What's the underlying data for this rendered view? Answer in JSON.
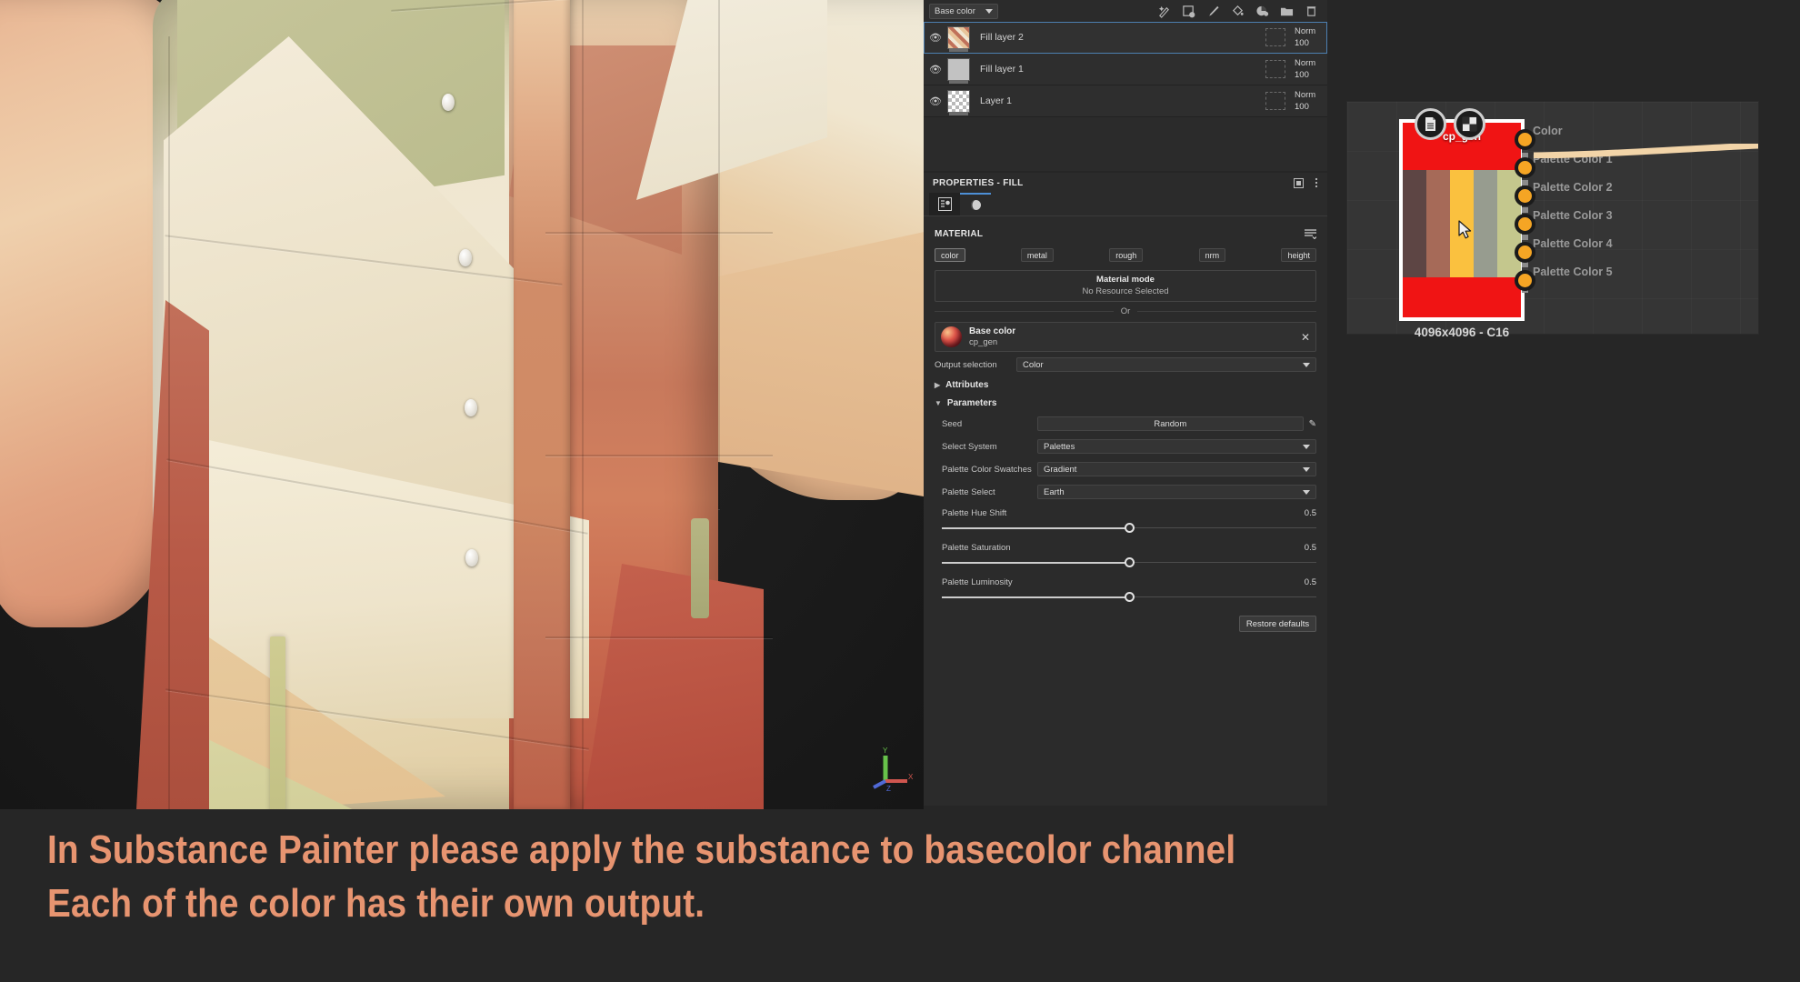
{
  "app": {
    "name": "Substance Painter"
  },
  "layers_panel": {
    "channel_selector": {
      "value": "Base color",
      "icon": "chevron-down-icon"
    },
    "tools": [
      {
        "name": "smart-mask-icon",
        "label": "Smart mask"
      },
      {
        "name": "smart-material-icon",
        "label": "Smart material"
      },
      {
        "name": "paint-layer-icon",
        "label": "Paint layer"
      },
      {
        "name": "fill-layer-icon",
        "label": "Fill layer"
      },
      {
        "name": "generator-icon",
        "label": "Generator"
      },
      {
        "name": "folder-icon",
        "label": "Folder"
      },
      {
        "name": "delete-icon",
        "label": "Delete"
      }
    ],
    "rows": [
      {
        "name": "Fill layer 2",
        "blend": "Norm",
        "opacity": "100",
        "selected": true,
        "thumb": "stripes"
      },
      {
        "name": "Fill layer 1",
        "blend": "Norm",
        "opacity": "100",
        "selected": false,
        "thumb": "grey"
      },
      {
        "name": "Layer 1",
        "blend": "Norm",
        "opacity": "100",
        "selected": false,
        "thumb": "checker"
      }
    ]
  },
  "properties": {
    "title": "PROPERTIES - FILL",
    "header_icons": [
      "dock-icon",
      "menu-icon"
    ],
    "tabs": [
      {
        "name": "properties-tab",
        "icon": "sliders-icon",
        "active": true
      },
      {
        "name": "material-tab",
        "icon": "sphere-icon",
        "active": false
      }
    ],
    "material": {
      "section_label": "MATERIAL",
      "menu_icon": "list-options-icon",
      "channels": [
        {
          "label": "color",
          "active": true
        },
        {
          "label": "metal",
          "active": false
        },
        {
          "label": "rough",
          "active": false
        },
        {
          "label": "nrm",
          "active": false
        },
        {
          "label": "height",
          "active": false
        }
      ],
      "mode_title": "Material mode",
      "mode_value": "No Resource Selected",
      "or_label": "Or",
      "resource": {
        "title": "Base color",
        "subtitle": "cp_gen",
        "close_icon": "close-icon"
      },
      "output_selection": {
        "label": "Output selection",
        "value": "Color"
      },
      "attributes_label": "Attributes",
      "parameters_label": "Parameters",
      "parameters": [
        {
          "label": "Seed",
          "type": "button",
          "value": "Random"
        },
        {
          "label": "Select System",
          "type": "select",
          "value": "Palettes"
        },
        {
          "label": "Palette Color Swatches",
          "type": "select",
          "value": "Gradient"
        },
        {
          "label": "Palette Select",
          "type": "select",
          "value": "Earth"
        }
      ],
      "sliders": [
        {
          "label": "Palette Hue Shift",
          "value": "0.5",
          "percent": 50
        },
        {
          "label": "Palette Saturation",
          "value": "0.5",
          "percent": 50
        },
        {
          "label": "Palette Luminosity",
          "value": "0.5",
          "percent": 50
        }
      ],
      "restore_label": "Restore defaults"
    }
  },
  "graph": {
    "node": {
      "label": "cp_gen",
      "resolution": "4096x4096 - C16",
      "body_color": "#f01414",
      "badges": [
        "document-icon",
        "checker-icon"
      ],
      "swatches": [
        "#5d4544",
        "#a66a58",
        "#fac13f",
        "#979c8f",
        "#c4c78d"
      ],
      "outputs": [
        {
          "label": "Color",
          "connected": true
        },
        {
          "label": "Palette Color 1",
          "connected": false
        },
        {
          "label": "Palette Color 2",
          "connected": false
        },
        {
          "label": "Palette Color 3",
          "connected": false
        },
        {
          "label": "Palette Color 4",
          "connected": false
        },
        {
          "label": "Palette Color 5",
          "connected": false
        }
      ],
      "wire_color": "#f2d4a8"
    },
    "cursor_icon": "mouse-pointer-icon"
  },
  "viewport": {
    "gizmo": {
      "x_label": "X",
      "y_label": "Y",
      "z_label": "Z",
      "x_color": "#d0564f",
      "y_color": "#67c24a",
      "z_color": "#5069d6"
    }
  },
  "caption": {
    "color": "#e79470",
    "line1": "In Substance Painter please apply the substance to basecolor channel",
    "line2": "Each of the color has their own output."
  }
}
